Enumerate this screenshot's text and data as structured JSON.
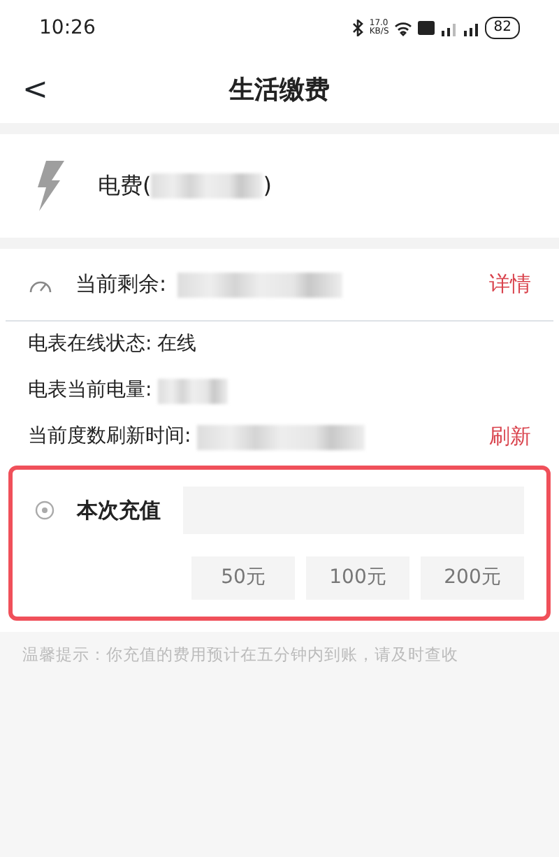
{
  "status_bar": {
    "time": "10:26",
    "net_speed": "17.0",
    "net_unit": "KB/S",
    "battery": "82"
  },
  "header": {
    "back": "<",
    "title": "生活缴费"
  },
  "bill": {
    "label": "电费(",
    "label_end": ")"
  },
  "remaining": {
    "label": "当前剩余:",
    "link": "详情"
  },
  "info_rows": [
    {
      "label": "电表在线状态:",
      "value": "在线",
      "link": ""
    },
    {
      "label": "电表当前电量:",
      "value": "",
      "link": ""
    },
    {
      "label": "当前度数刷新时间:",
      "value": "",
      "link": "刷新"
    }
  ],
  "recharge": {
    "label": "本次充值",
    "highlighted": true,
    "amounts": [
      {
        "label": "50元",
        "selected": false
      },
      {
        "label": "100元",
        "selected": false
      },
      {
        "label": "200元",
        "selected": false
      }
    ]
  },
  "hint": "温馨提示：你充值的费用预计在五分钟内到账，请及时查收"
}
